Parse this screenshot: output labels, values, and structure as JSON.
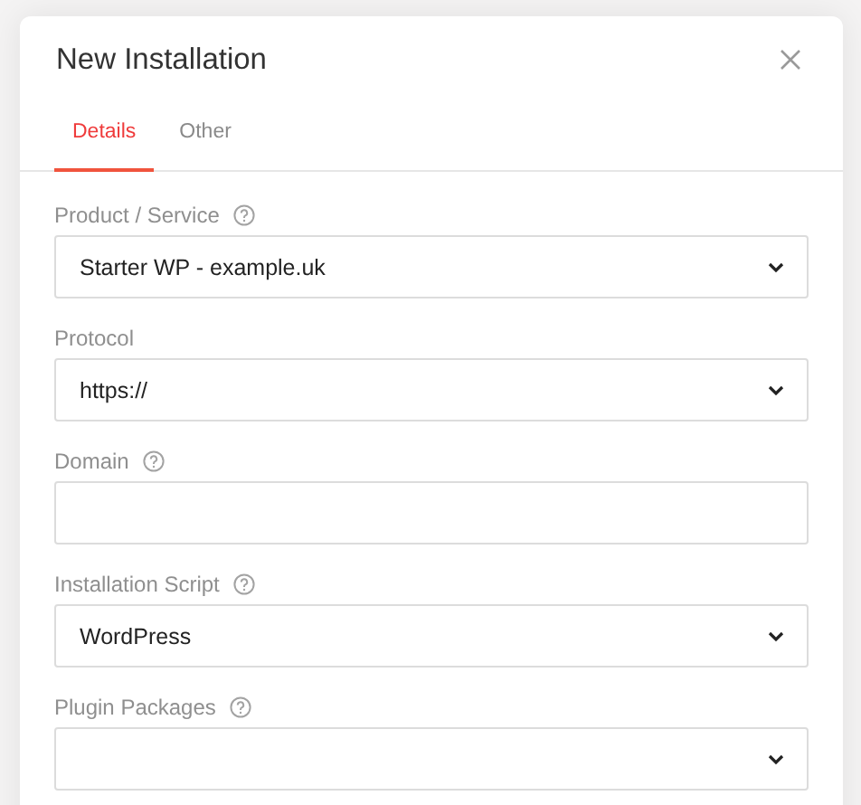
{
  "dialog": {
    "title": "New Installation"
  },
  "tabs": [
    {
      "label": "Details",
      "selected": true
    },
    {
      "label": "Other",
      "selected": false
    }
  ],
  "fields": [
    {
      "label": "Product / Service",
      "help": true,
      "kind": "select",
      "value": "Starter WP - example.uk"
    },
    {
      "label": "Protocol",
      "help": false,
      "kind": "select",
      "value": "https://"
    },
    {
      "label": "Domain",
      "help": true,
      "kind": "input"
    },
    {
      "label": "Installation Script",
      "help": true,
      "kind": "select",
      "value": "WordPress"
    },
    {
      "label": "Plugin Packages",
      "help": true,
      "kind": "select"
    }
  ]
}
